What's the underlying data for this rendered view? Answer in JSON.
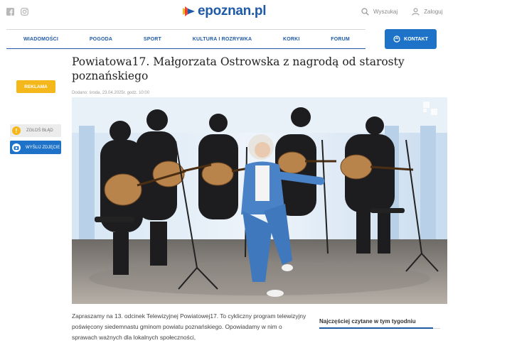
{
  "topbar": {
    "social": [
      "facebook-icon",
      "instagram-icon"
    ],
    "logo_text": "epoznan.pl",
    "search_label": "Wyszukaj",
    "login_label": "Zaloguj"
  },
  "nav": {
    "items": [
      "WIADOMOŚCI",
      "POGODA",
      "SPORT",
      "KULTURA I ROZRYWKA",
      "KORKI",
      "FORUM"
    ],
    "contact_label": "KONTAKT"
  },
  "article": {
    "title": "Powiatowa17. Małgorzata Ostrowska z nagrodą od starosty poznańskiego",
    "meta": "Dodano: środa, 23.04.2025r. godz. 10:00",
    "body": "Zapraszamy na 13. odcinek Telewizyjnej Powiatowej17. To cykliczny program telewizyjny poświęcony siedemnastu gminom powiatu poznańskiego. Opowiadamy w nim o sprawach ważnych dla lokalnych społeczności,"
  },
  "left_panel": {
    "ad_label": "REKLAMA",
    "report_label": "ZGŁOŚ BŁĄD",
    "search_news_label": "WYŚLIJ ZDJĘCIE"
  },
  "sidebar": {
    "most_read_heading": "Najczęściej czytane w tym tygodniu"
  },
  "colors": {
    "brand_blue": "#1e5aa8",
    "button_blue": "#1e73c8",
    "ad_yellow": "#f5b81c"
  }
}
